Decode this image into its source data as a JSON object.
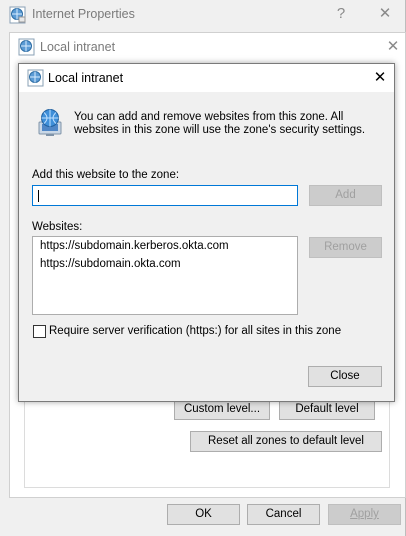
{
  "outer": {
    "title": "Internet Properties",
    "help_glyph": "?",
    "close_glyph": "✕",
    "buttons": {
      "ok": "OK",
      "cancel": "Cancel",
      "apply": "Apply"
    }
  },
  "middle": {
    "title": "Local intranet",
    "close_glyph": "✕",
    "buttons": {
      "custom_level": "Custom level...",
      "default_level": "Default level",
      "reset_all": "Reset all zones to default level"
    }
  },
  "dialog": {
    "title": "Local intranet",
    "close_glyph": "✕",
    "info_text": "You can add and remove websites from this zone. All websites in this zone will use the zone's security settings.",
    "add_label": "Add this website to the zone:",
    "add_input_value": "",
    "add_button": "Add",
    "websites_label": "Websites:",
    "websites": [
      "https://subdomain.kerberos.okta.com",
      "https://subdomain.okta.com"
    ],
    "remove_button": "Remove",
    "require_verification_label": "Require server verification (https:) for all sites in this zone",
    "require_verification_checked": false,
    "close_button": "Close"
  },
  "colors": {
    "accent": "#0078d7",
    "window_bg": "#f0f0f0",
    "disabled_text": "#a0a0a0"
  }
}
